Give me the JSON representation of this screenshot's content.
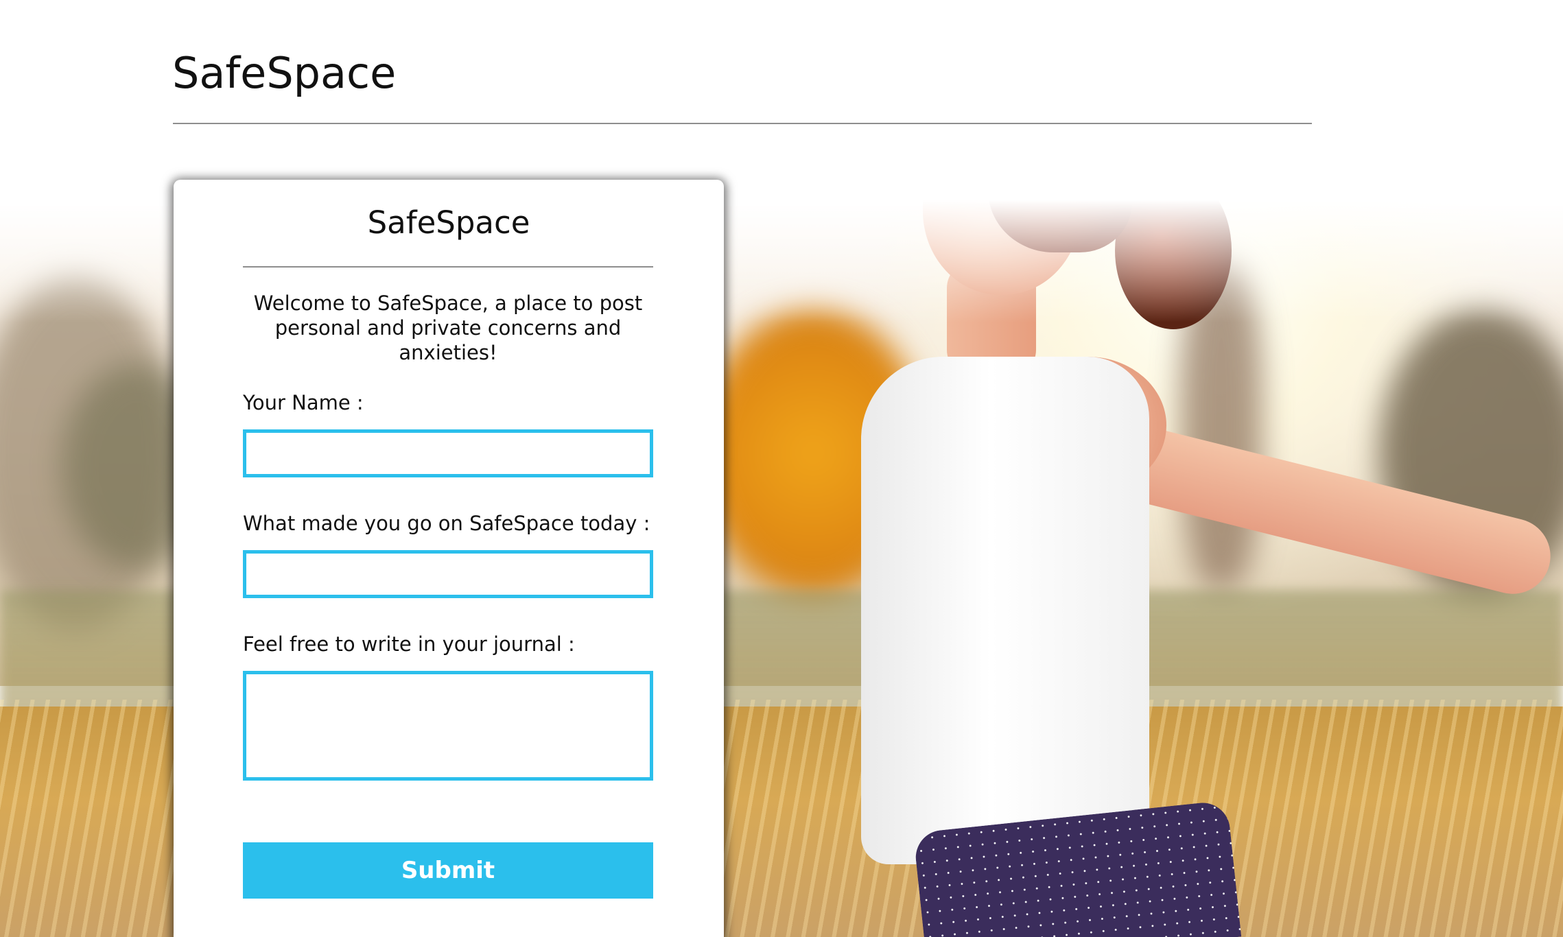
{
  "header": {
    "site_title": "SafeSpace"
  },
  "card": {
    "title": "SafeSpace",
    "welcome": "Welcome to SafeSpace, a place to post personal and private concerns and anxieties!",
    "fields": {
      "name_label": "Your Name :",
      "name_value": "",
      "reason_label": "What made you go on SafeSpace today :",
      "reason_value": "",
      "journal_label": "Feel free to write in your journal :",
      "journal_value": ""
    },
    "submit_label": "Submit"
  },
  "colors": {
    "accent": "#2bbfec",
    "text": "#111111",
    "rule": "#8e8e8e",
    "card_bg": "#ffffff"
  }
}
